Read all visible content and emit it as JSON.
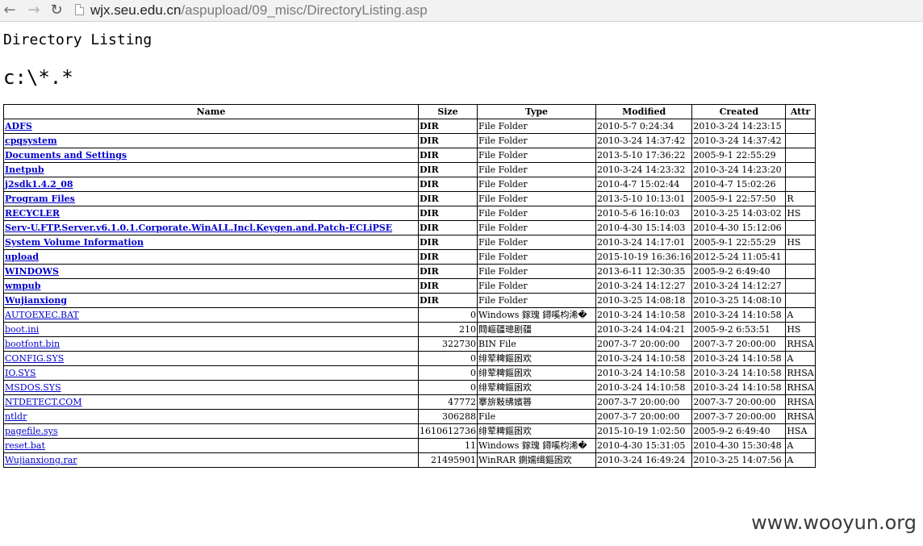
{
  "browser": {
    "url_host": "wjx.seu.edu.cn",
    "url_path": "/aspupload/09_misc/DirectoryListing.asp"
  },
  "page": {
    "heading": "Directory Listing",
    "path_title": "c:\\*.*"
  },
  "table": {
    "headers": [
      "Name",
      "Size",
      "Type",
      "Modified",
      "Created",
      "Attr"
    ],
    "rows": [
      {
        "name": "ADFS",
        "size": "DIR",
        "type": "File Folder",
        "modified": "2010-5-7 0:24:34",
        "created": "2010-3-24 14:23:15",
        "attr": "",
        "kind": "dir"
      },
      {
        "name": "cpqsystem",
        "size": "DIR",
        "type": "File Folder",
        "modified": "2010-3-24 14:37:42",
        "created": "2010-3-24 14:37:42",
        "attr": "",
        "kind": "dir"
      },
      {
        "name": "Documents and Settings",
        "size": "DIR",
        "type": "File Folder",
        "modified": "2013-5-10 17:36:22",
        "created": "2005-9-1 22:55:29",
        "attr": "",
        "kind": "dir"
      },
      {
        "name": "Inetpub",
        "size": "DIR",
        "type": "File Folder",
        "modified": "2010-3-24 14:23:32",
        "created": "2010-3-24 14:23:20",
        "attr": "",
        "kind": "dir"
      },
      {
        "name": "j2sdk1.4.2_08",
        "size": "DIR",
        "type": "File Folder",
        "modified": "2010-4-7 15:02:44",
        "created": "2010-4-7 15:02:26",
        "attr": "",
        "kind": "dir"
      },
      {
        "name": "Program Files",
        "size": "DIR",
        "type": "File Folder",
        "modified": "2013-5-10 10:13:01",
        "created": "2005-9-1 22:57:50",
        "attr": "R",
        "kind": "dir"
      },
      {
        "name": "RECYCLER",
        "size": "DIR",
        "type": "File Folder",
        "modified": "2010-5-6 16:10:03",
        "created": "2010-3-25 14:03:02",
        "attr": "HS",
        "kind": "dir"
      },
      {
        "name": "Serv-U.FTP.Server.v6.1.0.1.Corporate.WinALL.Incl.Keygen.and.Patch-ECLiPSE",
        "size": "DIR",
        "type": "File Folder",
        "modified": "2010-4-30 15:14:03",
        "created": "2010-4-30 15:12:06",
        "attr": "",
        "kind": "dir"
      },
      {
        "name": "System Volume Information",
        "size": "DIR",
        "type": "File Folder",
        "modified": "2010-3-24 14:17:01",
        "created": "2005-9-1 22:55:29",
        "attr": "HS",
        "kind": "dir"
      },
      {
        "name": "upload",
        "size": "DIR",
        "type": "File Folder",
        "modified": "2015-10-19 16:36:16",
        "created": "2012-5-24 11:05:41",
        "attr": "",
        "kind": "dir"
      },
      {
        "name": "WINDOWS",
        "size": "DIR",
        "type": "File Folder",
        "modified": "2013-6-11 12:30:35",
        "created": "2005-9-2 6:49:40",
        "attr": "",
        "kind": "dir"
      },
      {
        "name": "wmpub",
        "size": "DIR",
        "type": "File Folder",
        "modified": "2010-3-24 14:12:27",
        "created": "2010-3-24 14:12:27",
        "attr": "",
        "kind": "dir"
      },
      {
        "name": "Wujianxiong",
        "size": "DIR",
        "type": "File Folder",
        "modified": "2010-3-25 14:08:18",
        "created": "2010-3-25 14:08:10",
        "attr": "",
        "kind": "dir"
      },
      {
        "name": "AUTOEXEC.BAT",
        "size": "0",
        "type": "Windows 鎵瑰   鐞嗘枃浠�",
        "modified": "2010-3-24 14:10:58",
        "created": "2010-3-24 14:10:58",
        "attr": "A",
        "kind": "file"
      },
      {
        "name": "boot.ini",
        "size": "210",
        "type": "閰嶇疆璁剧疆",
        "modified": "2010-3-24 14:04:21",
        "created": "2005-9-2 6:53:51",
        "attr": "HS",
        "kind": "file"
      },
      {
        "name": "bootfont.bin",
        "size": "322730",
        "type": "BIN File",
        "modified": "2007-3-7 20:00:00",
        "created": "2007-3-7 20:00:00",
        "attr": "RHSA",
        "kind": "file"
      },
      {
        "name": "CONFIG.SYS",
        "size": "0",
        "type": "绯荤粺鏂囦欢",
        "modified": "2010-3-24 14:10:58",
        "created": "2010-3-24 14:10:58",
        "attr": "A",
        "kind": "file"
      },
      {
        "name": "IO.SYS",
        "size": "0",
        "type": "绯荤粺鏂囦欢",
        "modified": "2010-3-24 14:10:58",
        "created": "2010-3-24 14:10:58",
        "attr": "RHSA",
        "kind": "file"
      },
      {
        "name": "MSDOS.SYS",
        "size": "0",
        "type": "绯荤粺鏂囦欢",
        "modified": "2010-3-24 14:10:58",
        "created": "2010-3-24 14:10:58",
        "attr": "RHSA",
        "kind": "file"
      },
      {
        "name": "NTDETECT.COM",
        "size": "47772",
        "type": "搴旂敤绋嬪簭",
        "modified": "2007-3-7 20:00:00",
        "created": "2007-3-7 20:00:00",
        "attr": "RHSA",
        "kind": "file"
      },
      {
        "name": "ntldr",
        "size": "306288",
        "type": "File",
        "modified": "2007-3-7 20:00:00",
        "created": "2007-3-7 20:00:00",
        "attr": "RHSA",
        "kind": "file"
      },
      {
        "name": "pagefile.sys",
        "size": "1610612736",
        "type": "绯荤粺鏂囦欢",
        "modified": "2015-10-19 1:02:50",
        "created": "2005-9-2 6:49:40",
        "attr": "HSA",
        "kind": "file"
      },
      {
        "name": "reset.bat",
        "size": "11",
        "type": "Windows 鎵瑰   鐞嗘枃浠�",
        "modified": "2010-4-30 15:31:05",
        "created": "2010-4-30 15:30:48",
        "attr": "A",
        "kind": "file"
      },
      {
        "name": "Wujianxiong.rar",
        "size": "21495901",
        "type": "WinRAR 鍘嬬缉鏂囦欢",
        "modified": "2010-3-24 16:49:24",
        "created": "2010-3-25 14:07:56",
        "attr": "A",
        "kind": "file"
      }
    ]
  },
  "watermark": "www.wooyun.org",
  "colors": {
    "link": "#0000cc",
    "toolbar_bg": "#f2f2f2"
  }
}
